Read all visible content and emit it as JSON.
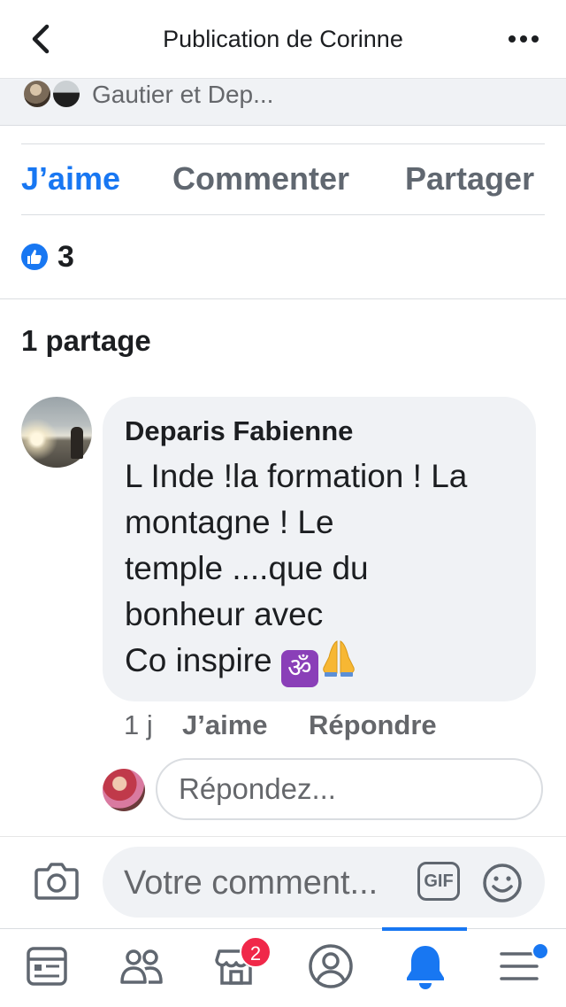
{
  "header": {
    "title": "Publication de Corinne"
  },
  "shared_by": {
    "text": "Gautier et Dep..."
  },
  "actions": {
    "like": "J’aime",
    "comment": "Commenter",
    "share": "Partager"
  },
  "reactions": {
    "count": "3"
  },
  "shares": {
    "label": "1 partage"
  },
  "comment": {
    "author": "Deparis Fabienne",
    "text": "L Inde !la formation ! La\nmontagne ! Le\ntemple ....que du\nbonheur avec\nCo inspire ",
    "emoji_om": "ॐ",
    "time": "1 j",
    "like_label": "J’aime",
    "reply_label": "Répondre"
  },
  "reply_box": {
    "placeholder": "Répondez..."
  },
  "composer": {
    "placeholder": "Votre comment...",
    "gif_label": "GIF"
  },
  "tabbar": {
    "notifications_badge": "2",
    "active_tab": "notifications"
  },
  "colors": {
    "accent": "#1877f2",
    "badge": "#f02849",
    "bubble": "#f0f2f5",
    "secondary_text": "#65676b"
  }
}
